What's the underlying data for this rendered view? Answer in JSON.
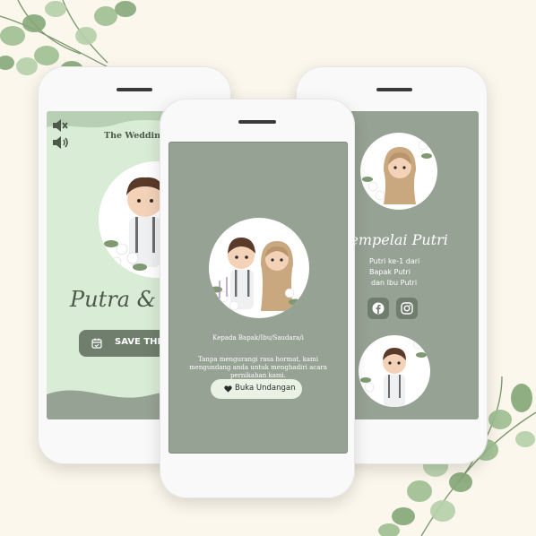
{
  "left_phone": {
    "heading": "The Wedding of",
    "names": "Putra & Putri",
    "save_label": "SAVE THE DATE",
    "mute_icon": "speaker-mute-icon",
    "sound_icon": "speaker-on-icon",
    "calendar_icon": "calendar-icon"
  },
  "center_phone": {
    "recipient": "Kepada Bapak/Ibu/Saudara/i",
    "message": "Tanpa mengurangi rasa hormat, kami mengundang anda untuk menghadiri acara pernikahan kami.",
    "open_label": "Buka Undangan",
    "heart_icon": "heart-icon"
  },
  "right_phone": {
    "title": "Mempelai Putri",
    "child_order": "Putri ke-1 dari",
    "father": "Bapak Putri",
    "mother": "dan Ibu Putri",
    "facebook_icon": "facebook-icon",
    "instagram_icon": "instagram-icon"
  },
  "colors": {
    "background": "#fbf7ec",
    "sage": "#96a294",
    "sage_dark": "#8a9688",
    "mint": "#d9ecd6",
    "title_green": "#4d5a4a",
    "button_green": "#6f7e6d",
    "pill": "#e9f2e4"
  }
}
